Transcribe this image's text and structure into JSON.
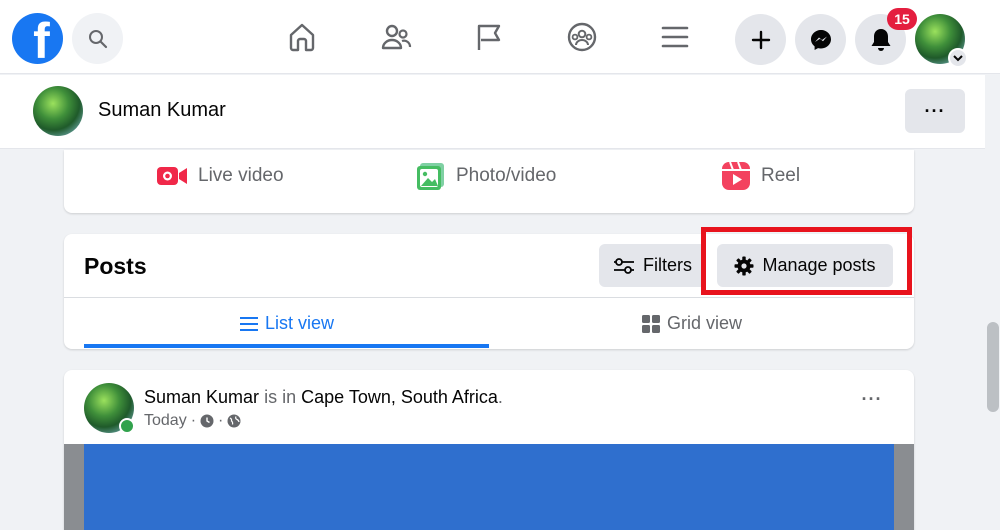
{
  "topbar": {
    "logo_letter": "f",
    "notification_count": "15",
    "icons": [
      "search-icon",
      "home-icon",
      "friends-icon",
      "flag-icon",
      "groups-icon",
      "menu-icon",
      "plus-icon",
      "messenger-icon",
      "bell-icon",
      "chevron-down-icon"
    ]
  },
  "profile": {
    "name": "Suman Kumar",
    "more_label": "···"
  },
  "composer": {
    "live_label": "Live video",
    "photo_label": "Photo/video",
    "reel_label": "Reel"
  },
  "posts": {
    "title": "Posts",
    "filters_label": "Filters",
    "manage_label": "Manage posts",
    "tabs": [
      {
        "label": "List view",
        "active": true
      },
      {
        "label": "Grid view",
        "active": false
      }
    ]
  },
  "post": {
    "author": "Suman Kumar",
    "is_in": "is in",
    "location": "Cape Town, South Africa",
    "period": ".",
    "time": "Today",
    "dot": "·",
    "more_label": "···"
  },
  "colors": {
    "brand": "#1877f2",
    "highlight": "#e8131d",
    "badge": "#e41e3f",
    "online": "#31a24c",
    "media": "#2f6fce"
  }
}
